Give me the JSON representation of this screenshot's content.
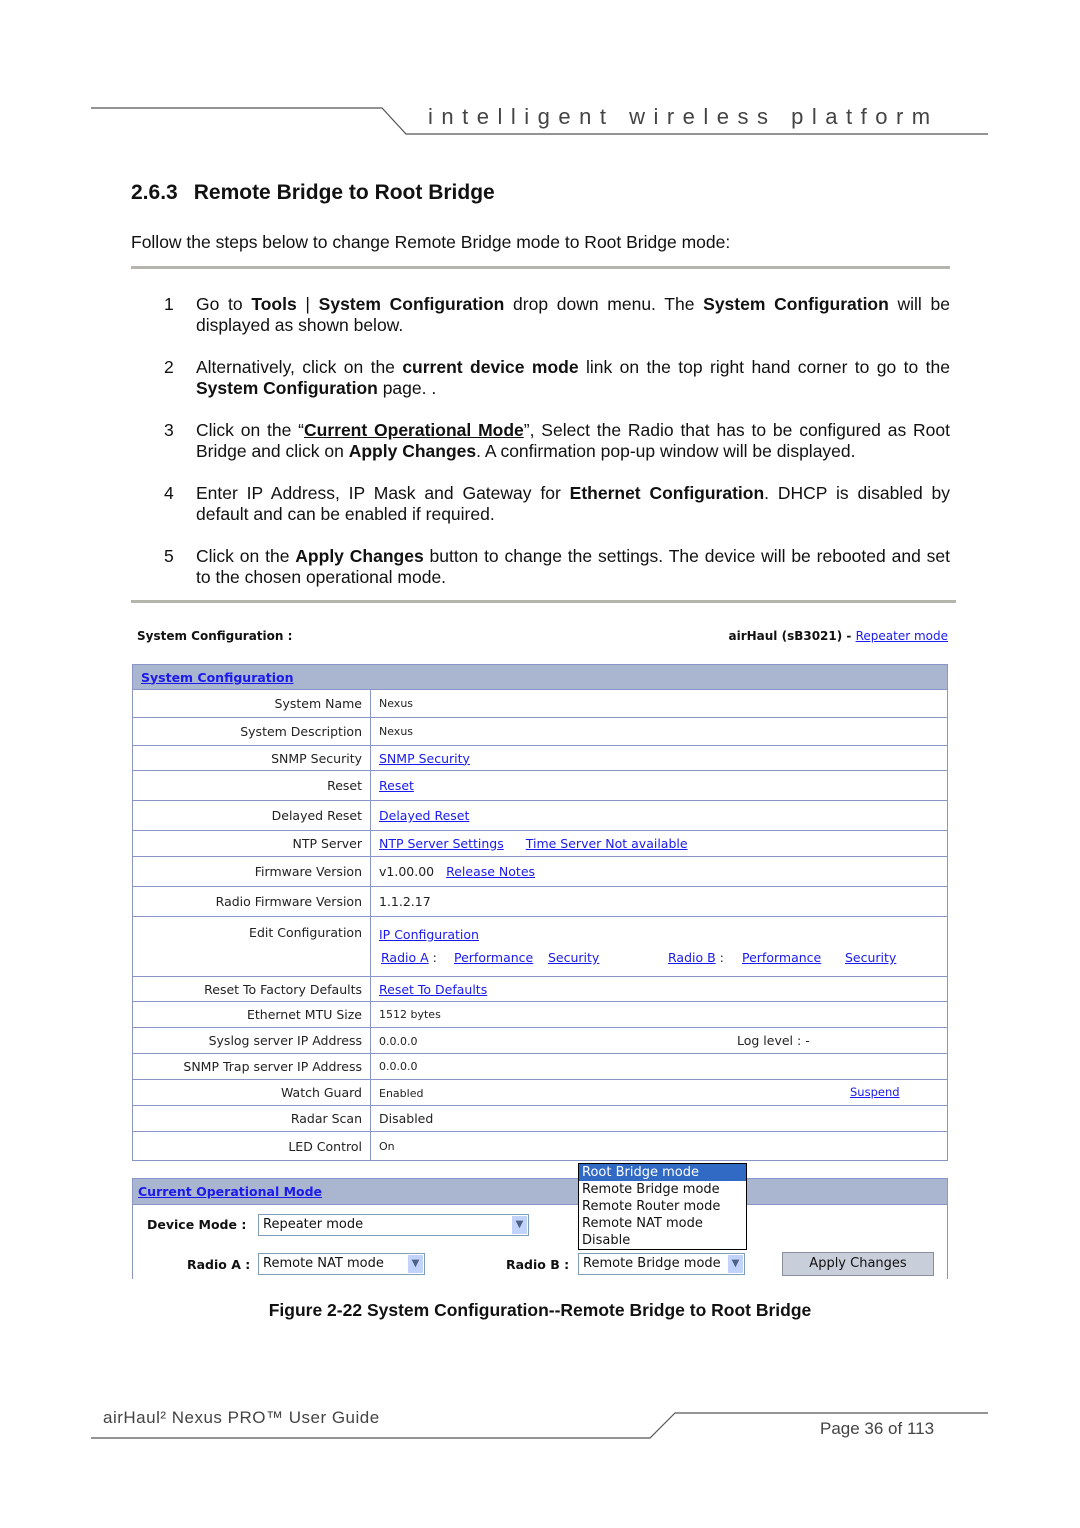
{
  "header": {
    "tagline": "intelligent   wireless   platform"
  },
  "section": {
    "number": "2.6.3",
    "title": "Remote Bridge to Root Bridge",
    "intro": "Follow the steps below to change Remote Bridge mode to Root Bridge mode:"
  },
  "steps": [
    {
      "n": "1",
      "html": "Go to <b>Tools</b> | <b>System Configuration</b> drop down menu.  The <b>System Configuration</b> will be displayed as shown below."
    },
    {
      "n": "2",
      "html": "Alternatively, click on the <b>current device mode</b> link on the top right hand corner to go to the <b>System Configuration</b> page. ."
    },
    {
      "n": "3",
      "html": "Click on the “<b><u>Current Operational Mode</u></b>”, Select the Radio that has to be configured as Root Bridge and click on <b>Apply Changes</b>.  A confirmation pop-up window will be displayed."
    },
    {
      "n": "4",
      "html": "Enter IP Address, IP Mask and Gateway for <b>Ethernet Configuration</b>. DHCP is disabled by default and can be enabled if required."
    },
    {
      "n": "5",
      "html": "Click on the <b>Apply Changes</b> button to change the settings. The device will be rebooted and set to the chosen operational mode."
    }
  ],
  "screenshot": {
    "title": "System Configuration :",
    "device": "airHaul (sB3021) - ",
    "mode_link": "Repeater mode",
    "section_link": "System Configuration",
    "rows": {
      "system_name": {
        "label": "System Name",
        "value": "Nexus"
      },
      "system_description": {
        "label": "System Description",
        "value": "Nexus"
      },
      "snmp_security": {
        "label": "SNMP Security",
        "link": "SNMP Security"
      },
      "reset": {
        "label": "Reset",
        "link": "Reset"
      },
      "delayed_reset": {
        "label": "Delayed Reset",
        "link": "Delayed Reset"
      },
      "ntp": {
        "label": "NTP Server",
        "link": "NTP Server Settings",
        "link2": "Time Server Not available"
      },
      "firmware": {
        "label": "Firmware Version",
        "value": "v1.00.00",
        "link": "Release Notes"
      },
      "radio_firmware": {
        "label": "Radio Firmware Version",
        "value": "1.1.2.17"
      },
      "edit": {
        "label": "Edit Configuration",
        "ip": "IP Configuration",
        "radio_a": "Radio A",
        "radio_b": "Radio B",
        "sep": ":",
        "performance": "Performance",
        "security": "Security"
      },
      "factory": {
        "label": "Reset To Factory Defaults",
        "link": "Reset To Defaults"
      },
      "mtu": {
        "label": "Ethernet MTU Size",
        "value": "1512 bytes"
      },
      "syslog": {
        "label": "Syslog server IP Address",
        "value": "0.0.0.0",
        "log_label": "Log level :",
        "log_value": "-"
      },
      "snmp_trap": {
        "label": "SNMP Trap server IP Address",
        "value": "0.0.0.0"
      },
      "watch_guard": {
        "label": "Watch Guard",
        "value": "Enabled",
        "link": "Suspend"
      },
      "radar": {
        "label": "Radar Scan",
        "value": "Disabled"
      },
      "led": {
        "label": "LED Control",
        "value": "On"
      }
    },
    "op_mode_link": "Current Operational Mode",
    "device_mode_label": "Device Mode :",
    "device_mode_value": "Repeater mode",
    "radio_a_label": "Radio A :",
    "radio_a_value": "Remote NAT mode",
    "radio_b_label": "Radio B :",
    "radio_b_value": "Remote Bridge mode",
    "dropdown_options": [
      "Root Bridge mode",
      "Remote Bridge mode",
      "Remote Router mode",
      "Remote NAT mode",
      "Disable"
    ],
    "dropdown_highlighted": "Root Bridge mode",
    "apply_label": "Apply Changes"
  },
  "caption": "Figure 2-22 System Configuration--Remote Bridge to Root Bridge",
  "footer": {
    "guide": "airHaul² Nexus PRO™ User Guide",
    "page": "Page 36 of 113"
  }
}
